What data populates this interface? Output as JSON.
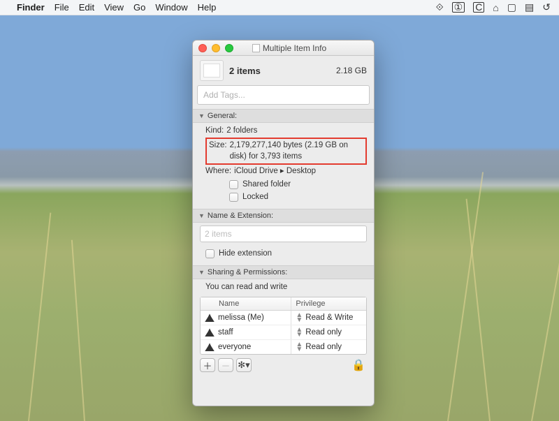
{
  "menubar": {
    "app": "Finder",
    "items": [
      "File",
      "Edit",
      "View",
      "Go",
      "Window",
      "Help"
    ]
  },
  "window": {
    "title": "Multiple Item Info",
    "summary": {
      "items_label": "2 items",
      "total_size": "2.18 GB"
    },
    "tags_placeholder": "Add Tags...",
    "general": {
      "header": "General:",
      "kind_label": "Kind:",
      "kind_value": "2 folders",
      "size_label": "Size:",
      "size_value": "2,179,277,140 bytes (2.19 GB on disk) for 3,793 items",
      "where_label": "Where:",
      "where_value": "iCloud Drive ▸ Desktop",
      "shared_folder_label": "Shared folder",
      "locked_label": "Locked"
    },
    "name_ext": {
      "header": "Name & Extension:",
      "value": "2 items",
      "hide_ext_label": "Hide extension"
    },
    "sharing": {
      "header": "Sharing & Permissions:",
      "note": "You can read and write",
      "columns": {
        "name": "Name",
        "priv": "Privilege"
      },
      "rows": [
        {
          "name": "melissa (Me)",
          "priv": "Read & Write"
        },
        {
          "name": "staff",
          "priv": "Read only"
        },
        {
          "name": "everyone",
          "priv": "Read only"
        }
      ]
    }
  }
}
